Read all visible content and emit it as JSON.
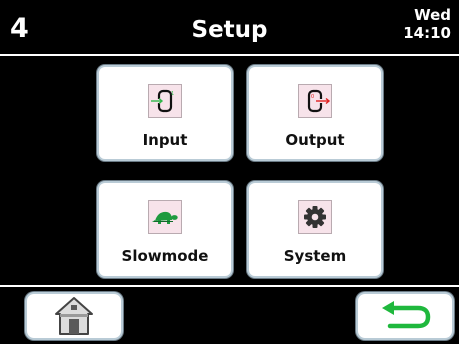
{
  "header": {
    "page_number": "4",
    "title": "Setup",
    "day": "Wed",
    "time": "14:10"
  },
  "menu": {
    "tiles": [
      {
        "label": "Input",
        "icon": "input-signal-icon"
      },
      {
        "label": "Output",
        "icon": "output-signal-icon"
      },
      {
        "label": "Slowmode",
        "icon": "turtle-icon"
      },
      {
        "label": "System",
        "icon": "gear-icon"
      }
    ]
  },
  "footer": {
    "home_icon": "home-icon",
    "back_icon": "return-arrow-icon"
  },
  "colors": {
    "background": "#000000",
    "tile_icon_background": "#f7e3ea",
    "tile_border": "#b9cbd6",
    "input_arrow": "#2fb84a",
    "output_arrow": "#e02020",
    "turtle": "#1f9a3f",
    "back_arrow": "#1fb83d"
  }
}
